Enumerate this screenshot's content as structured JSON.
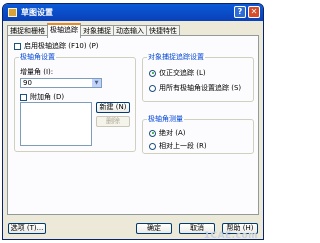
{
  "window": {
    "title": "草图设置"
  },
  "tabs": [
    "捕捉和栅格",
    "极轴追踪",
    "对象捕捉",
    "动态输入",
    "快捷特性"
  ],
  "active_tab": "极轴追踪",
  "enable": {
    "label": "启用极轴追踪 (F10) (P)",
    "checked": false
  },
  "angle_group": {
    "legend": "极轴角设置",
    "increment_label": "增量角 (I):",
    "increment_value": "90",
    "additional_label": "附加角 (D)",
    "additional_checked": false,
    "new_button": "新建 (N)",
    "delete_button": "删除"
  },
  "snap_tracking_group": {
    "legend": "对象捕捉追踪设置",
    "option_orthogonal": "仅正交追踪 (L)",
    "option_all": "用所有极轴角设置追踪 (S)",
    "selected": "orthogonal"
  },
  "measure_group": {
    "legend": "极轴角测量",
    "option_absolute": "绝对 (A)",
    "option_relative": "相对上一段 (R)",
    "selected": "absolute"
  },
  "footer": {
    "options": "选项 (T)...",
    "ok": "确定",
    "cancel": "取消",
    "help": "帮助 (H)"
  },
  "watermark": "1CAE.com"
}
